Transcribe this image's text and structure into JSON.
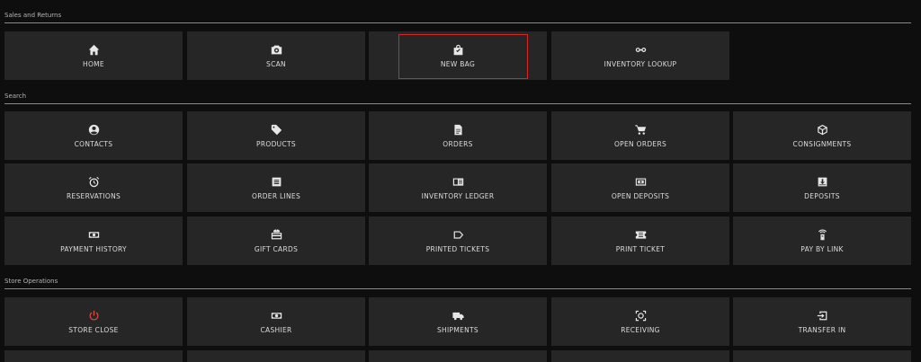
{
  "sections": {
    "sales": "Sales and Returns",
    "search": "Search",
    "store_ops": "Store Operations"
  },
  "tiles": {
    "home": {
      "label": "HOME",
      "icon": "home-icon"
    },
    "scan": {
      "label": "SCAN",
      "icon": "camera-icon"
    },
    "new_bag": {
      "label": "NEW BAG",
      "icon": "shopping-bag-icon"
    },
    "inventory_lookup": {
      "label": "INVENTORY LOOKUP",
      "icon": "glasses-icon"
    },
    "contacts": {
      "label": "CONTACTS",
      "icon": "user-circle-icon"
    },
    "products": {
      "label": "PRODUCTS",
      "icon": "tag-icon"
    },
    "orders": {
      "label": "ORDERS",
      "icon": "document-icon"
    },
    "open_orders": {
      "label": "OPEN ORDERS",
      "icon": "cart-icon"
    },
    "consignments": {
      "label": "CONSIGNMENTS",
      "icon": "box-icon"
    },
    "reservations": {
      "label": "RESERVATIONS",
      "icon": "alarm-clock-icon"
    },
    "order_lines": {
      "label": "ORDER LINES",
      "icon": "list-box-icon"
    },
    "inventory_ledger": {
      "label": "INVENTORY LEDGER",
      "icon": "ledger-icon"
    },
    "open_deposits": {
      "label": "OPEN DEPOSITS",
      "icon": "cash-register-icon"
    },
    "deposits": {
      "label": "DEPOSITS",
      "icon": "tray-download-icon"
    },
    "payment_history": {
      "label": "PAYMENT HISTORY",
      "icon": "banknote-icon"
    },
    "gift_cards": {
      "label": "GIFT CARDS",
      "icon": "gift-icon"
    },
    "printed_tickets": {
      "label": "PRINTED TICKETS",
      "icon": "label-tag-icon"
    },
    "print_ticket": {
      "label": "PRINT TICKET",
      "icon": "ticket-icon"
    },
    "pay_by_link": {
      "label": "PAY BY LINK",
      "icon": "wireless-phone-icon"
    },
    "store_close": {
      "label": "STORE CLOSE",
      "icon": "power-icon",
      "color": "#e04a3a"
    },
    "cashier": {
      "label": "CASHIER",
      "icon": "banknote-icon"
    },
    "shipments": {
      "label": "SHIPMENTS",
      "icon": "truck-icon"
    },
    "receiving": {
      "label": "RECEIVING",
      "icon": "scan-target-icon"
    },
    "transfer_in": {
      "label": "TRANSFER IN",
      "icon": "sign-in-icon"
    }
  },
  "colors": {
    "background": "#0e0e0e",
    "tile": "#262626",
    "highlight": "#d62626"
  }
}
